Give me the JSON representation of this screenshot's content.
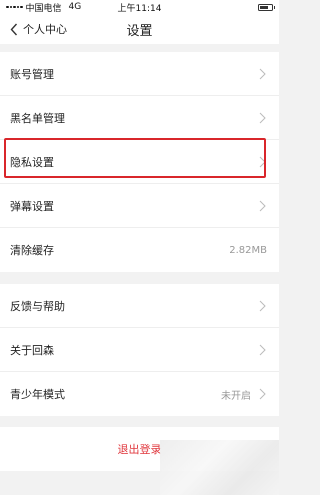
{
  "status_bar": {
    "carrier": "中国电信",
    "network": "4G",
    "time": "上午11:14"
  },
  "nav": {
    "back_label": "个人中心",
    "title": "设置"
  },
  "groups": [
    [
      {
        "label": "账号管理",
        "value": "",
        "chevron": true
      },
      {
        "label": "黑名单管理",
        "value": "",
        "chevron": true
      },
      {
        "label": "隐私设置",
        "value": "",
        "chevron": true,
        "highlighted": true
      },
      {
        "label": "弹幕设置",
        "value": "",
        "chevron": true
      },
      {
        "label": "清除缓存",
        "value": "2.82MB",
        "chevron": false
      }
    ],
    [
      {
        "label": "反馈与帮助",
        "value": "",
        "chevron": true
      },
      {
        "label": "关于回森",
        "value": "",
        "chevron": true
      },
      {
        "label": "青少年模式",
        "value": "未开启",
        "chevron": true
      }
    ]
  ],
  "logout": {
    "label": "退出登录"
  },
  "colors": {
    "accent": "#e0383e",
    "highlight_border": "#d9262b"
  }
}
